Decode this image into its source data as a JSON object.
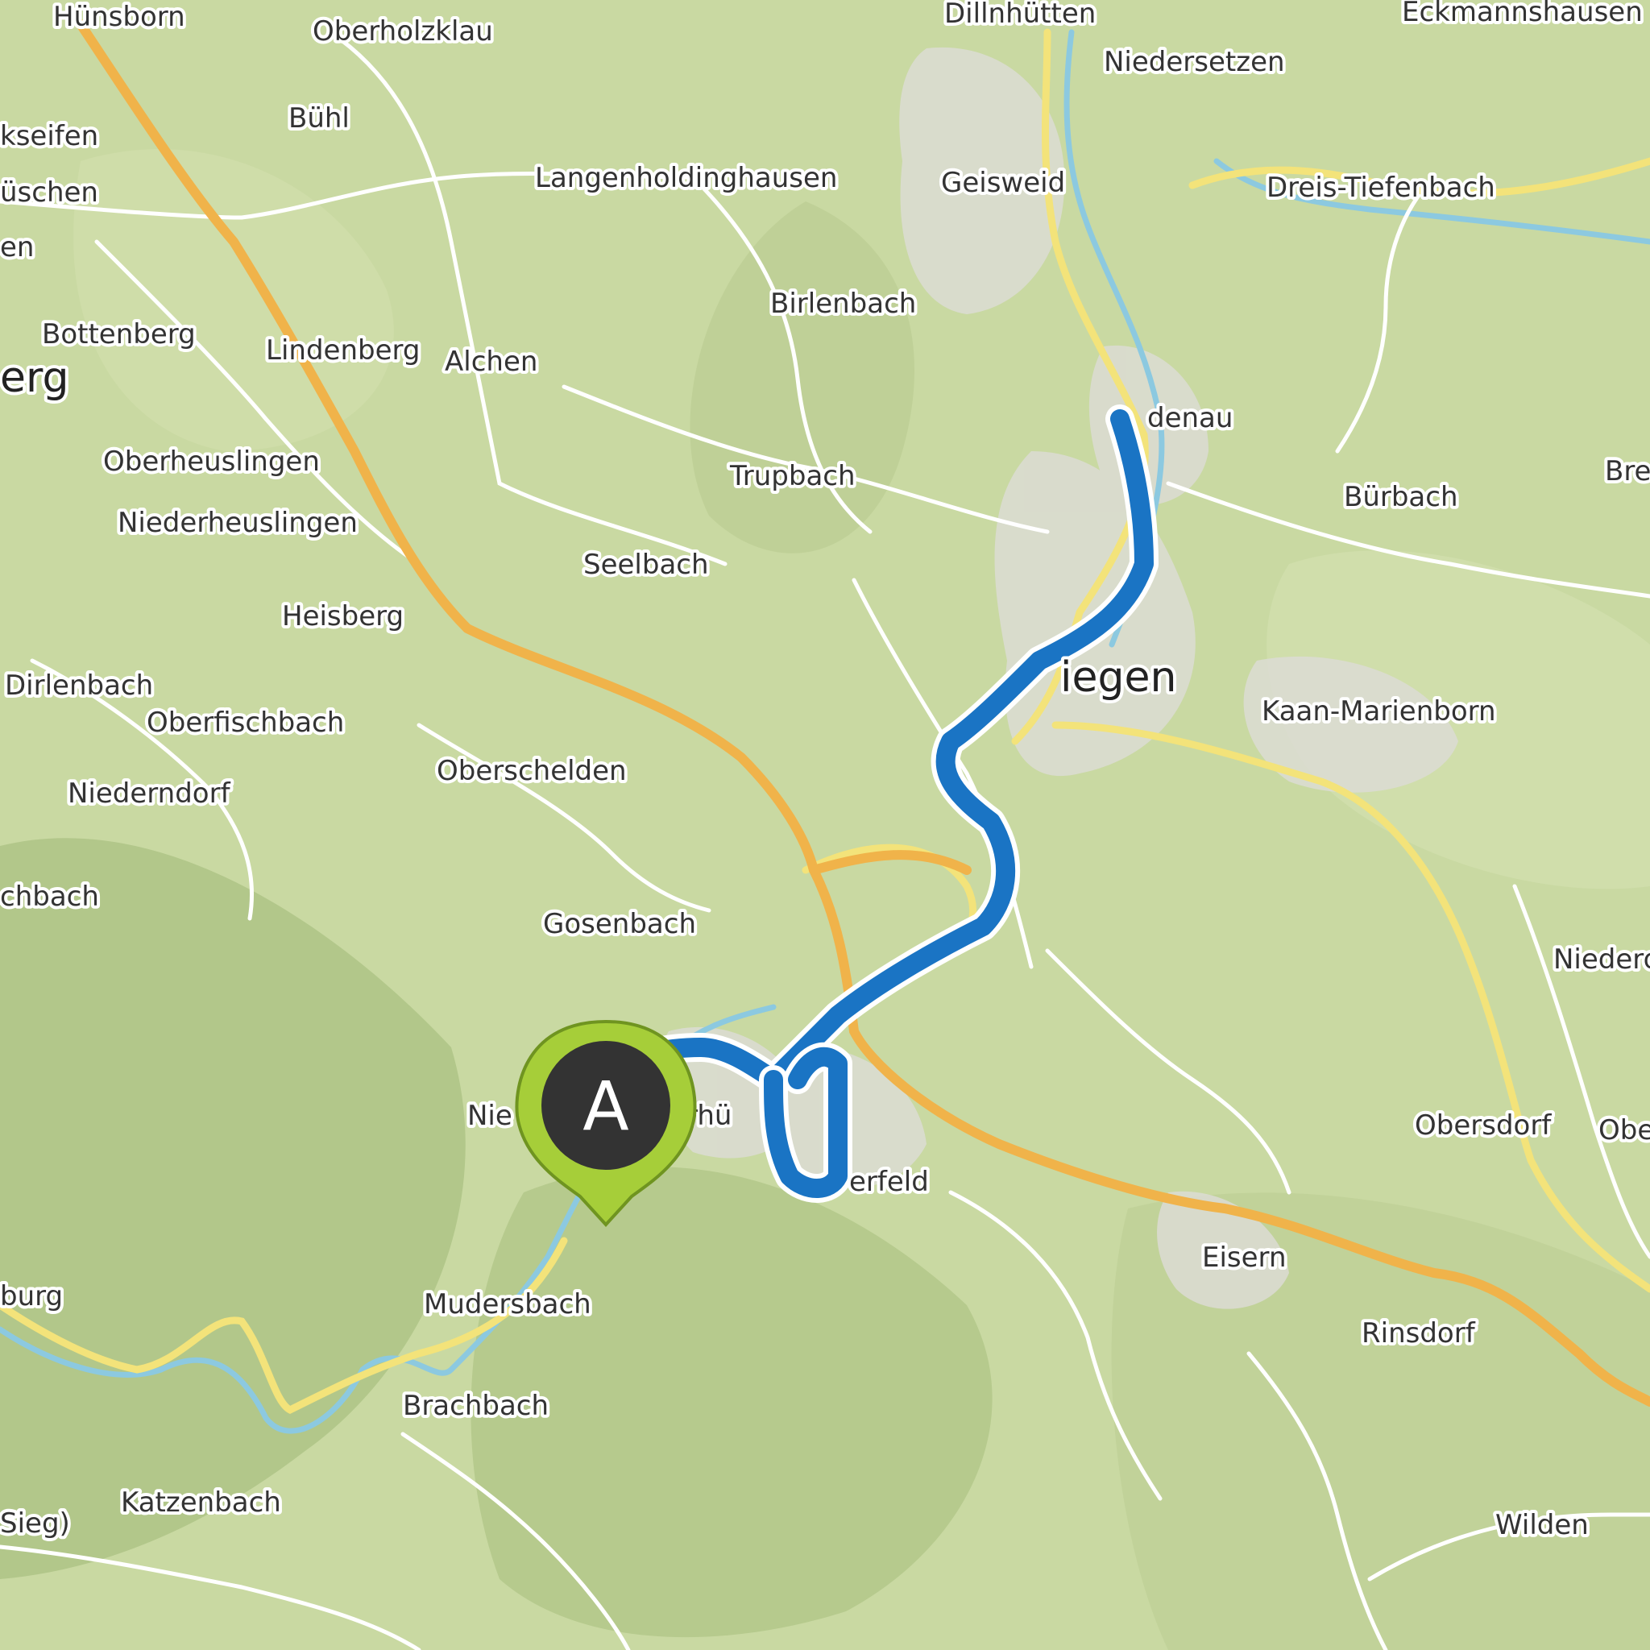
{
  "map": {
    "colors": {
      "terrain": "#c9d9a2",
      "route": "#1a74c4",
      "motorway": "#f0b34a",
      "primary_road": "#f3e37a",
      "minor_road": "#ffffff",
      "water": "#8cc9e0",
      "marker_fill": "#a6ce39",
      "marker_core": "#333333"
    },
    "labels": {
      "hunsborn": "Hünsborn",
      "oberholzklau": "Oberholzklau",
      "dillnhuetten": "Dillnhütten",
      "eckmannshausen": "Eckmannshausen",
      "niedersetzen": "Niedersetzen",
      "buehl": "Bühl",
      "kseifen": "kseifen",
      "langenholdinghausen": "Langenholdinghausen",
      "geisweid": "Geisweid",
      "dreis_tiefenbach": "Dreis-Tiefenbach",
      "ueschen": "üschen",
      "en": "en",
      "bottenberg": "Bottenberg",
      "lindenberg": "Lindenberg",
      "alchen": "Alchen",
      "birlenbach": "Birlenbach",
      "erg": "erg",
      "denau": "denau",
      "oberheuslingen": "Oberheuslingen",
      "trupbach": "Trupbach",
      "buerbach": "Bürbach",
      "bre": "Bre",
      "niederheuslingen": "Niederheuslingen",
      "seelbach": "Seelbach",
      "heisberg": "Heisberg",
      "siegen": "iegen",
      "dirlenbach": "Dirlenbach",
      "kaan_marienborn": "Kaan-Marienborn",
      "oberfischbach": "Oberfischbach",
      "oberschelden": "Oberschelden",
      "niederndorf": "Niederndorf",
      "chbach": "chbach",
      "gosenbach": "Gosenbach",
      "niederd": "Niederd",
      "nie": "Nie",
      "rhue": "rhü",
      "erfeld": "erfeld",
      "obersdorf": "Obersdorf",
      "obe": "Obe",
      "eisern": "Eisern",
      "burg": "burg",
      "mudersbach": "Mudersbach",
      "rinsdorf": "Rinsdorf",
      "brachbach": "Brachbach",
      "katzenbach": "Katzenbach",
      "sieg": "Sieg)",
      "wilden": "Wilden"
    },
    "marker": {
      "letter": "A",
      "icon": "map-pin-icon"
    }
  }
}
